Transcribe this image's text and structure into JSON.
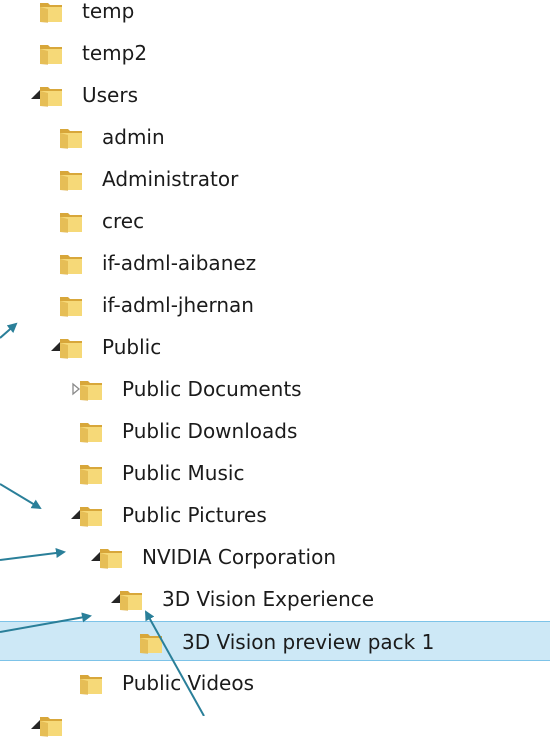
{
  "colors": {
    "folder_light": "#f6d978",
    "folder_dark": "#d8a73a",
    "arrow": "#2a7f99",
    "selection_bg": "#cde8f6",
    "selection_border": "#7dc3e8"
  },
  "tree": {
    "items": [
      {
        "label": "temp",
        "depth": 1,
        "expander": "none",
        "selected": false
      },
      {
        "label": "temp2",
        "depth": 1,
        "expander": "none",
        "selected": false
      },
      {
        "label": "Users",
        "depth": 1,
        "expander": "expanded",
        "selected": false
      },
      {
        "label": "admin",
        "depth": 2,
        "expander": "none",
        "selected": false
      },
      {
        "label": "Administrator",
        "depth": 2,
        "expander": "none",
        "selected": false
      },
      {
        "label": "crec",
        "depth": 2,
        "expander": "none",
        "selected": false
      },
      {
        "label": "if-adml-aibanez",
        "depth": 2,
        "expander": "none",
        "selected": false
      },
      {
        "label": "if-adml-jhernan",
        "depth": 2,
        "expander": "none",
        "selected": false
      },
      {
        "label": "Public",
        "depth": 2,
        "expander": "expanded",
        "selected": false
      },
      {
        "label": "Public Documents",
        "depth": 3,
        "expander": "collapsed",
        "selected": false
      },
      {
        "label": "Public Downloads",
        "depth": 3,
        "expander": "none",
        "selected": false
      },
      {
        "label": "Public Music",
        "depth": 3,
        "expander": "none",
        "selected": false
      },
      {
        "label": "Public Pictures",
        "depth": 3,
        "expander": "expanded",
        "selected": false
      },
      {
        "label": "NVIDIA Corporation",
        "depth": 4,
        "expander": "expanded",
        "selected": false
      },
      {
        "label": "3D Vision Experience",
        "depth": 5,
        "expander": "expanded",
        "selected": false
      },
      {
        "label": "3D Vision preview pack 1",
        "depth": 6,
        "expander": "none",
        "selected": true
      },
      {
        "label": "Public Videos",
        "depth": 3,
        "expander": "none",
        "selected": false
      },
      {
        "label": "",
        "depth": 1,
        "expander": "expanded",
        "selected": false
      }
    ]
  }
}
